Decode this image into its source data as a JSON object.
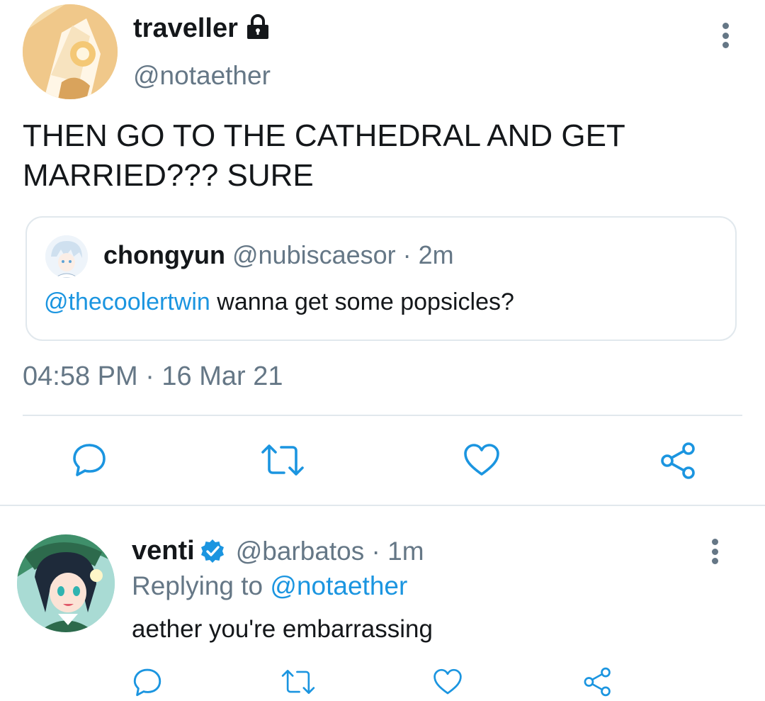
{
  "tweet": {
    "author": {
      "name": "traveller",
      "handle": "@notaether",
      "protected_icon": "lock-icon",
      "avatar_icon": "traveller-avatar"
    },
    "text": "THEN GO TO THE CATHEDRAL AND GET MARRIED??? SURE",
    "quote": {
      "name": "chongyun",
      "meta": "@nubiscaesor · 2m",
      "mention": "@thecoolertwin",
      "text": " wanna get some popsicles?",
      "avatar_icon": "chongyun-avatar"
    },
    "timestamp": "04:58 PM · 16 Mar 21",
    "actions": [
      "reply-icon",
      "retweet-icon",
      "like-icon",
      "share-icon"
    ],
    "more_icon": "more-options-icon"
  },
  "reply": {
    "author": {
      "name": "venti",
      "verified_icon": "verified-badge-icon",
      "meta": "@barbatos · 1m",
      "avatar_icon": "venti-avatar"
    },
    "replying_prefix": "Replying to ",
    "replying_handle": "@notaether",
    "text": "aether you're embarrassing",
    "actions": [
      "reply-icon",
      "retweet-icon",
      "like-icon",
      "share-icon"
    ],
    "more_icon": "more-options-icon"
  },
  "colors": {
    "accent": "#1b95e0",
    "text": "#14171a",
    "secondary": "#657786",
    "divider": "#e1e8ed"
  }
}
